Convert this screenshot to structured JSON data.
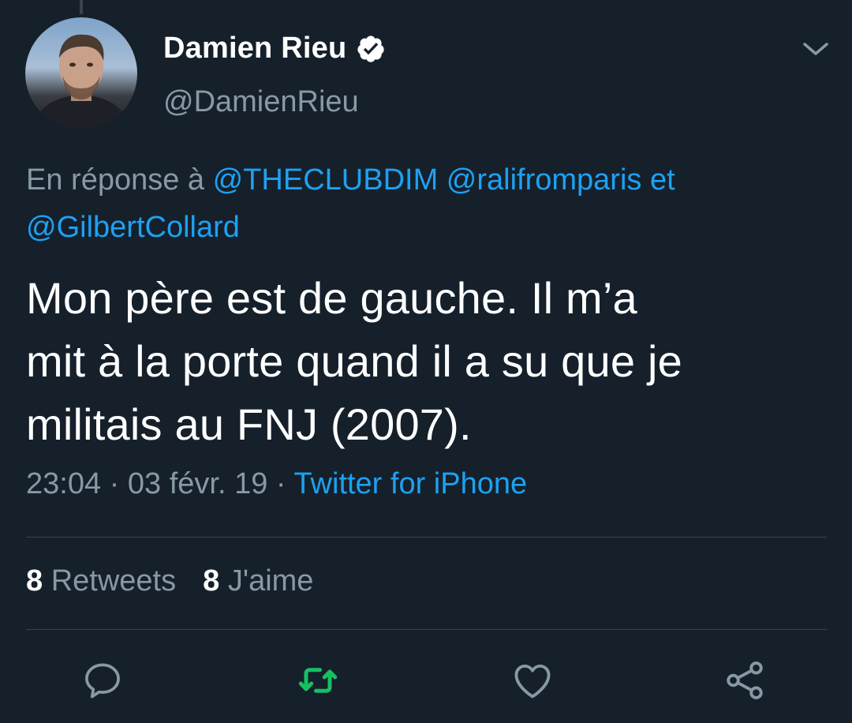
{
  "tweet": {
    "author": {
      "display_name": "Damien Rieu",
      "handle": "@DamienRieu",
      "verified": true
    },
    "reply_to": {
      "prefix": "En réponse à",
      "mention_1": "@THECLUBDIM",
      "mention_2": "@ralifromparis",
      "conjunction": "et",
      "mention_3": "@GilbertCollard"
    },
    "text_line_1": "Mon père est de gauche. Il m’a",
    "text_line_2": "mit à la porte quand il a su que je",
    "text_line_3": "militais au FNJ (2007).",
    "time": "23:04",
    "date": "03 févr. 19",
    "separator": "·",
    "source": "Twitter for iPhone",
    "stats": {
      "retweets_count": "8",
      "retweets_label": "Retweets",
      "likes_count": "8",
      "likes_label": "J'aime"
    }
  },
  "icons": {
    "verified": "verified-badge-icon",
    "menu": "chevron-down-icon",
    "reply": "reply-icon",
    "retweet": "retweet-icon",
    "like": "heart-icon",
    "share": "share-icon"
  },
  "colors": {
    "background": "#15202b",
    "link": "#1da1f2",
    "secondary_text": "#8899a6",
    "retweet_green": "#17bf63",
    "divider": "#38444d"
  }
}
